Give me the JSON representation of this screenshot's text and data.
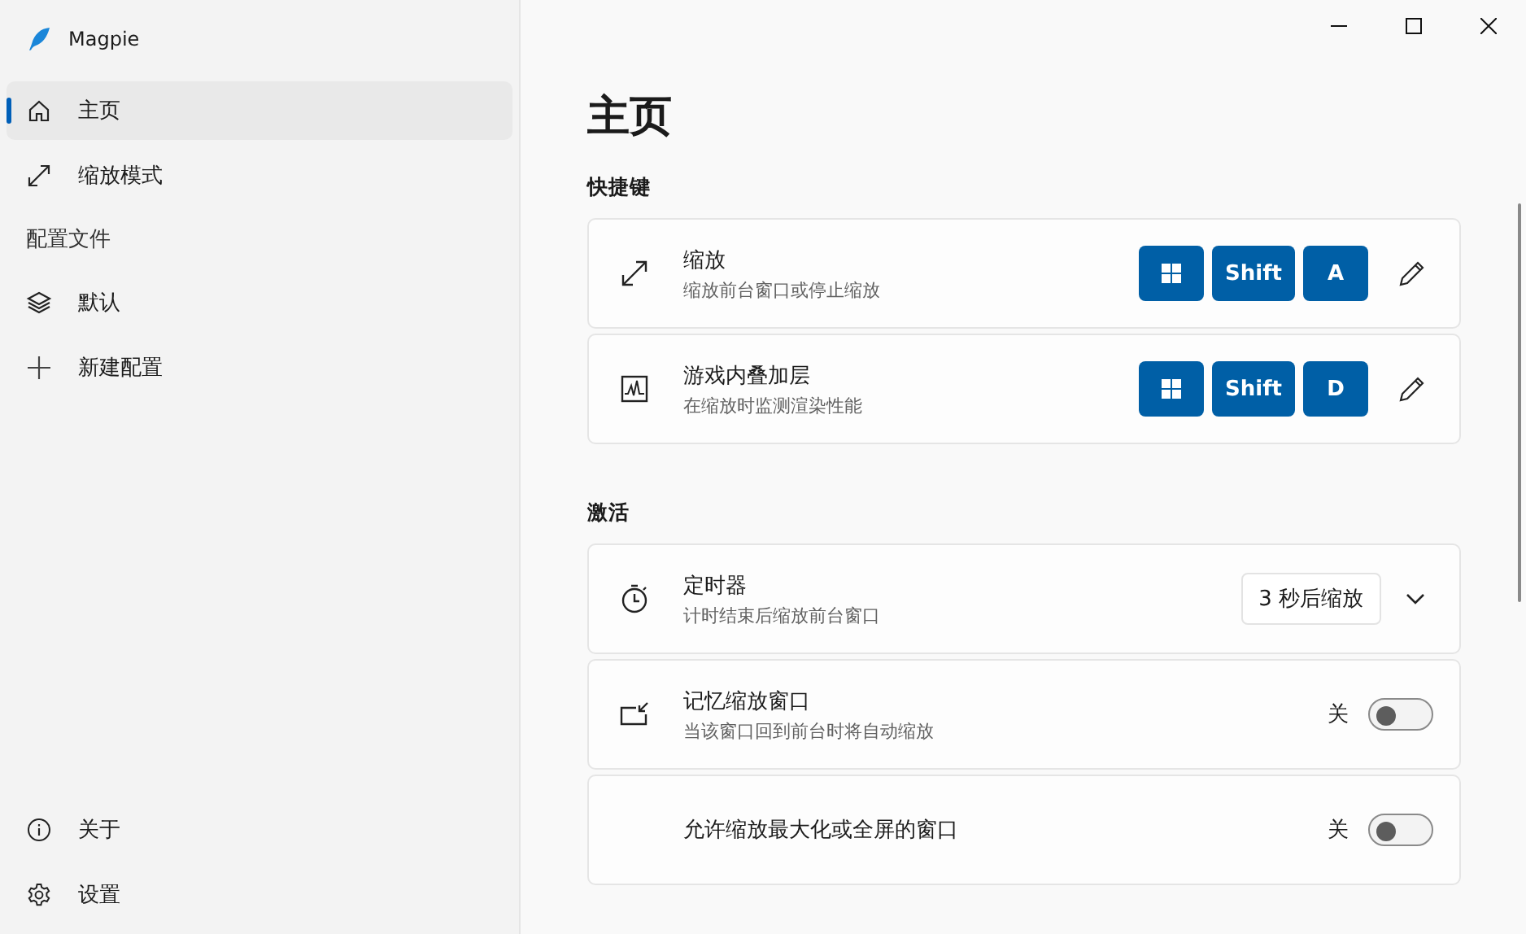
{
  "app": {
    "title": "Magpie"
  },
  "nav": [
    {
      "label": "主页",
      "selected": true
    },
    {
      "label": "缩放模式",
      "selected": false
    }
  ],
  "profiles_heading": "配置文件",
  "profiles": [
    {
      "label": "默认",
      "selected": false
    },
    {
      "label": "新建配置",
      "selected": false
    }
  ],
  "footer_nav": [
    {
      "label": "关于",
      "selected": false
    },
    {
      "label": "设置",
      "selected": false
    }
  ],
  "page_title": "主页",
  "sections": [
    {
      "heading": "快捷键",
      "rows": [
        {
          "kind": "shortcut",
          "title": "缩放",
          "subtitle": "缩放前台窗口或停止缩放",
          "keys": [
            {
              "kind": "win"
            },
            {
              "kind": "text",
              "label": "Shift"
            },
            {
              "kind": "text",
              "label": "A"
            }
          ]
        },
        {
          "kind": "shortcut",
          "title": "游戏内叠加层",
          "subtitle": "在缩放时监测渲染性能",
          "keys": [
            {
              "kind": "win"
            },
            {
              "kind": "text",
              "label": "Shift"
            },
            {
              "kind": "text",
              "label": "D"
            }
          ]
        }
      ]
    },
    {
      "heading": "激活",
      "rows": [
        {
          "kind": "dropdown",
          "title": "定时器",
          "subtitle": "计时结束后缩放前台窗口",
          "value": "3 秒后缩放",
          "expanded": false
        },
        {
          "kind": "toggle",
          "title": "记忆缩放窗口",
          "subtitle": "当该窗口回到前台时将自动缩放",
          "state_label": "关",
          "on": false
        },
        {
          "kind": "toggle",
          "title": "允许缩放最大化或全屏的窗口",
          "state_label": "关",
          "on": false
        }
      ]
    }
  ]
}
